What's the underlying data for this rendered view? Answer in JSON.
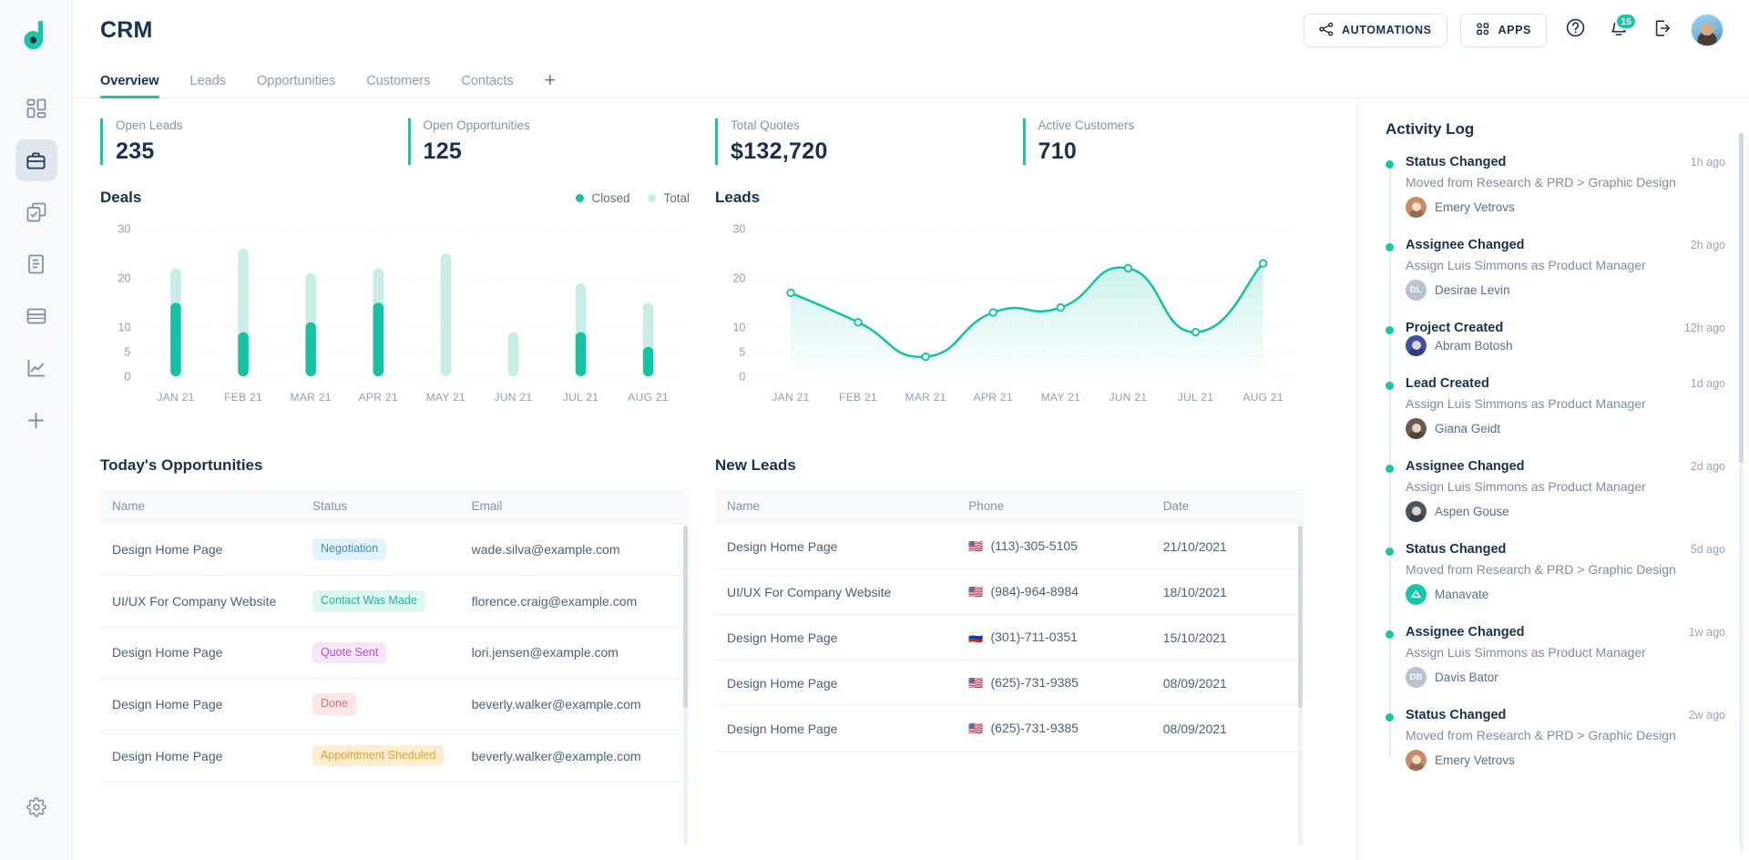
{
  "app": {
    "title": "CRM",
    "logo_icon": "droplet-logo-icon"
  },
  "sidebar": {
    "items": [
      {
        "icon": "dashboard-grid-icon",
        "name": "dashboard",
        "active": false
      },
      {
        "icon": "briefcase-icon",
        "name": "crm",
        "active": true
      },
      {
        "icon": "tasks-check-icon",
        "name": "tasks",
        "active": false
      },
      {
        "icon": "document-icon",
        "name": "documents",
        "active": false
      },
      {
        "icon": "wallet-card-icon",
        "name": "billing",
        "active": false
      },
      {
        "icon": "analytics-chart-icon",
        "name": "analytics",
        "active": false
      },
      {
        "icon": "plus-icon",
        "name": "add",
        "active": false
      }
    ],
    "settings": {
      "icon": "gear-icon",
      "name": "settings"
    }
  },
  "topbar": {
    "automations_label": "AUTOMATIONS",
    "automations_icon": "share-nodes-icon",
    "apps_label": "APPS",
    "apps_icon": "apps-grid-icon",
    "help_icon": "help-circle-icon",
    "notifications_icon": "bell-icon",
    "notifications_count": "15",
    "logout_icon": "logout-icon",
    "avatar_icon": "user-avatar"
  },
  "tabs": {
    "items": [
      {
        "label": "Overview",
        "active": true
      },
      {
        "label": "Leads",
        "active": false
      },
      {
        "label": "Opportunities",
        "active": false
      },
      {
        "label": "Customers",
        "active": false
      },
      {
        "label": "Contacts",
        "active": false
      }
    ],
    "add_label": "+"
  },
  "kpis": [
    {
      "label": "Open Leads",
      "value": "235"
    },
    {
      "label": "Open Opportunities",
      "value": "125"
    },
    {
      "label": "Total Quotes",
      "value": "$132,720"
    },
    {
      "label": "Active Customers",
      "value": "710"
    }
  ],
  "colors": {
    "accent": "#18c7a8",
    "accent_light": "#c8ece6",
    "navy": "#17314f",
    "muted": "#8294ab"
  },
  "chart_data": [
    {
      "type": "bar",
      "title": "Deals",
      "categories": [
        "JAN 21",
        "FEB 21",
        "MAR 21",
        "APR 21",
        "MAY 21",
        "JUN 21",
        "JUL 21",
        "AUG 21"
      ],
      "series": [
        {
          "name": "Total",
          "color": "#c8ece6",
          "values": [
            22,
            26,
            21,
            22,
            25,
            9,
            19,
            15
          ]
        },
        {
          "name": "Closed",
          "color": "#14c2a4",
          "values": [
            15,
            9,
            11,
            15,
            0,
            0,
            9,
            6
          ]
        }
      ],
      "legend": [
        "Closed",
        "Total"
      ],
      "legend_position": "top-right",
      "yticks": [
        0,
        5,
        10,
        20,
        30
      ],
      "ylim": [
        0,
        30
      ],
      "xlabel": "",
      "ylabel": "",
      "grid": true
    },
    {
      "type": "area",
      "title": "Leads",
      "categories": [
        "JAN 21",
        "FEB 21",
        "MAR 21",
        "APR 21",
        "MAY 21",
        "JUN 21",
        "JUL 21",
        "AUG 21"
      ],
      "series": [
        {
          "name": "Leads",
          "color": "#14c2a4",
          "values": [
            17,
            11,
            4,
            13,
            14,
            22,
            9,
            23
          ]
        }
      ],
      "yticks": [
        0,
        5,
        10,
        20,
        30
      ],
      "ylim": [
        0,
        30
      ],
      "xlabel": "",
      "ylabel": "",
      "grid": true
    }
  ],
  "opportunities": {
    "title": "Today's Opportunities",
    "columns": [
      "Name",
      "Status",
      "Email"
    ],
    "rows": [
      {
        "name": "Design Home Page",
        "status": "Negotiation",
        "status_bg": "#e4f2fb",
        "status_fg": "#3b8fc9",
        "email": "wade.silva@example.com"
      },
      {
        "name": "UI/UX For Company Website",
        "status": "Contact Was Made",
        "status_bg": "#ddf6ef",
        "status_fg": "#21b892",
        "email": "florence.craig@example.com"
      },
      {
        "name": "Design Home Page",
        "status": "Quote Sent",
        "status_bg": "#f7e6f7",
        "status_fg": "#b košice",
        "email": "lori.jensen@example.com"
      },
      {
        "name": "Design Home Page",
        "status": "Done",
        "status_bg": "#fde6e6",
        "status_fg": "#ef6b6b",
        "email": "beverly.walker@example.com"
      },
      {
        "name": "Design Home Page",
        "status": "Appointment Sheduled",
        "status_bg": "#fdeed3",
        "status_fg": "#f0a02a",
        "email": "beverly.walker@example.com"
      }
    ]
  },
  "new_leads": {
    "title": "New Leads",
    "columns": [
      "Name",
      "Phone",
      "Date"
    ],
    "rows": [
      {
        "name": "Design Home Page",
        "flag": "🇺🇸",
        "phone": "(113)-305-5105",
        "date": "21/10/2021"
      },
      {
        "name": "UI/UX For Company Website",
        "flag": "🇺🇸",
        "phone": "(984)-964-8984",
        "date": "18/10/2021"
      },
      {
        "name": "Design Home Page",
        "flag": "🇷🇺",
        "phone": "(301)-711-0351",
        "date": "15/10/2021"
      },
      {
        "name": "Design Home Page",
        "flag": "🇺🇸",
        "phone": "(625)-731-9385",
        "date": "08/09/2021"
      },
      {
        "name": "Design Home Page",
        "flag": "🇺🇸",
        "phone": "(625)-731-9385",
        "date": "08/09/2021"
      }
    ]
  },
  "activity": {
    "title": "Activity Log",
    "items": [
      {
        "event": "Status Changed",
        "time": "1h ago",
        "desc": "Moved from Research & PRD > Graphic Design",
        "user": "Emery Vetrovs",
        "avatar_type": "photo",
        "avatar_color": "#c98a6a",
        "initials": ""
      },
      {
        "event": "Assignee Changed",
        "time": "2h ago",
        "desc": "Assign Luis Simmons as Product Manager",
        "user": "Desirae Levin",
        "avatar_type": "initials",
        "avatar_color": "#b9c3cf",
        "initials": "DL"
      },
      {
        "event": "Project Created",
        "time": "12h ago",
        "desc": "",
        "user": "Abram Botosh",
        "avatar_type": "photo",
        "avatar_color": "#3d52a0",
        "initials": ""
      },
      {
        "event": "Lead Created",
        "time": "1d ago",
        "desc": "Assign Luis Simmons as Product Manager",
        "user": "Giana Geidt",
        "avatar_type": "photo",
        "avatar_color": "#6b5a4a",
        "initials": ""
      },
      {
        "event": "Assignee Changed",
        "time": "2d ago",
        "desc": "Assign Luis Simmons as Product Manager",
        "user": "Aspen Gouse",
        "avatar_type": "photo",
        "avatar_color": "#4a5560",
        "initials": ""
      },
      {
        "event": "Status Changed",
        "time": "5d ago",
        "desc": "Moved from Research & PRD > Graphic Design",
        "user": "Manavate",
        "avatar_type": "logo",
        "avatar_color": "#18c7a8",
        "initials": ""
      },
      {
        "event": "Assignee Changed",
        "time": "1w ago",
        "desc": "Assign Luis Simmons as Product Manager",
        "user": "Davis Bator",
        "avatar_type": "initials",
        "avatar_color": "#b9c3cf",
        "initials": "DB"
      },
      {
        "event": "Status Changed",
        "time": "2w ago",
        "desc": "Moved from Research & PRD > Graphic Design",
        "user": "Emery Vetrovs",
        "avatar_type": "photo",
        "avatar_color": "#c98a6a",
        "initials": ""
      }
    ]
  }
}
